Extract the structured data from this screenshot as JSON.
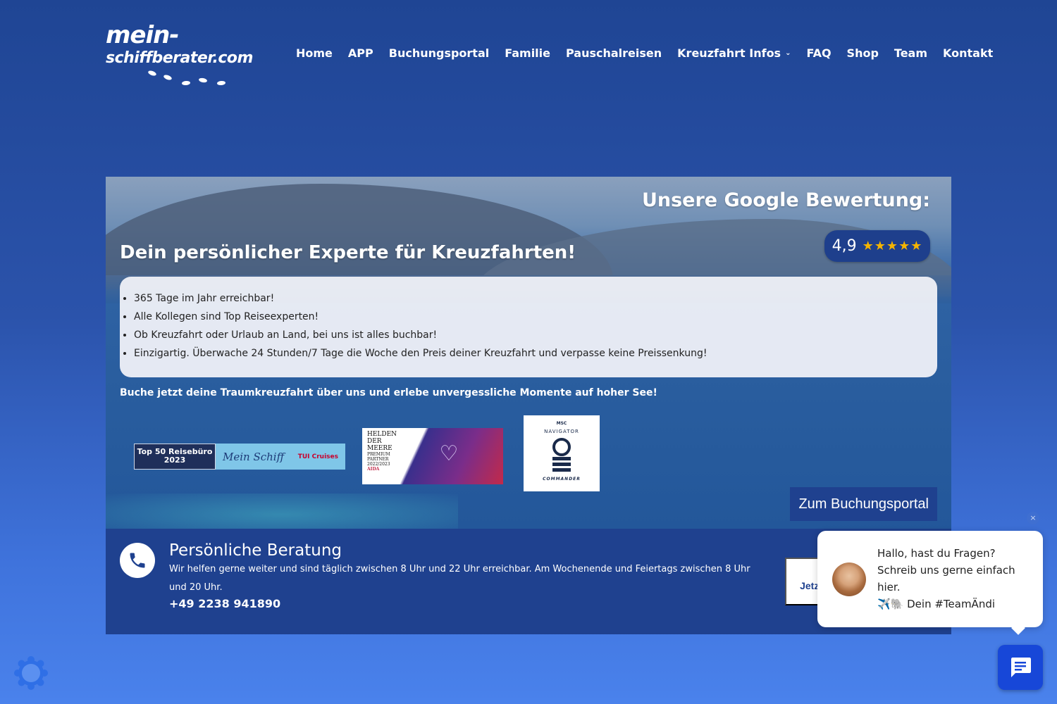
{
  "header": {
    "logo_line1": "mein-",
    "logo_line2": "schiffberater.com",
    "nav": [
      {
        "label": "Home"
      },
      {
        "label": "APP"
      },
      {
        "label": "Buchungsportal"
      },
      {
        "label": "Familie"
      },
      {
        "label": "Pauschalreisen"
      },
      {
        "label": "Kreuzfahrt Infos",
        "icon": "chevron-down-icon"
      },
      {
        "label": "FAQ"
      },
      {
        "label": "Shop"
      },
      {
        "label": "Team"
      },
      {
        "label": "Kontakt"
      }
    ]
  },
  "hero": {
    "google_title": "Unsere Google Bewertung:",
    "rating_value": "4,9",
    "rating_stars": "★★★★★",
    "headline": "Dein persönlicher Experte für Kreuzfahrten!",
    "bullets": [
      "365 Tage im Jahr erreichbar!",
      "Alle Kollegen sind Top Reiseexperten!",
      "Ob Kreuzfahrt oder Urlaub an Land, bei uns ist alles buchbar!",
      "Einzigartig. Überwache 24 Stunden/7 Tage die Woche den Preis deiner Kreuzfahrt und verpasse keine Preissenkung!"
    ],
    "cta_text": "Buche jetzt deine Traumkreuzfahrt über uns und erlebe unvergessliche Momente auf hoher See!",
    "badge_top50": {
      "line1": "Top 50 Reisebüro",
      "line2": "2023",
      "brand": "Mein Schiff",
      "partner": "TUI Cruises"
    },
    "badge_helden": {
      "l1": "HELDEN",
      "l2": "DER",
      "l3": "MEERE",
      "l4": "PREMIUM",
      "l5": "PARTNER",
      "l6": "2022/2023",
      "brand": "AIDA"
    },
    "badge_msc": {
      "brand": "MSC",
      "title": "NAVIGATOR",
      "rank": "COMMANDER"
    },
    "portal_button": "Zum Buchungsportal"
  },
  "beratung": {
    "title": "Persönliche Beratung",
    "text": "Wir helfen gerne weiter und sind täglich zwischen 8 Uhr und 22 Uhr erreichbar. Am Wochenende und Feiertags zwischen 8 Uhr und 20 Uhr.",
    "phone": "+49 2238 941890",
    "button_partial": "Jetz einr"
  },
  "chat": {
    "close": "×",
    "message_line1": "Hallo, hast du Fragen?",
    "message_line2": "Schreib uns gerne einfach hier.",
    "message_line3": "✈️🐘 Dein #TeamÄndi"
  },
  "colors": {
    "accent": "#1f418f",
    "chat_button": "#1747d8",
    "star": "#f4b400"
  }
}
